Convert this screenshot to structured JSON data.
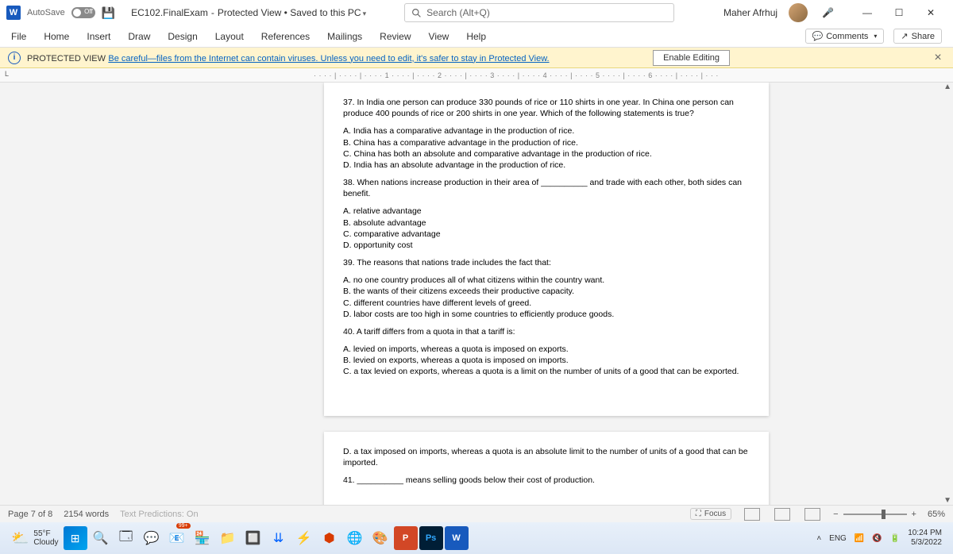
{
  "titlebar": {
    "word_letter": "W",
    "autosave": "AutoSave",
    "autosave_state": "Off",
    "doc_name": "EC102.FinalExam",
    "doc_status": "Protected View • Saved to this PC",
    "search_placeholder": "Search (Alt+Q)",
    "user": "Maher Afrhuj"
  },
  "tabs": {
    "file": "File",
    "home": "Home",
    "insert": "Insert",
    "draw": "Draw",
    "design": "Design",
    "layout": "Layout",
    "references": "References",
    "mailings": "Mailings",
    "review": "Review",
    "view": "View",
    "help": "Help",
    "comments": "Comments",
    "share": "Share"
  },
  "protected": {
    "label": "PROTECTED VIEW",
    "message": "Be careful—files from the Internet can contain viruses. Unless you need to edit, it's safer to stay in Protected View.",
    "enable": "Enable Editing"
  },
  "ruler": {
    "l": "L",
    "marks": "· · · · | · · · · | · · · · 1 · · · · | · · · · 2 · · · · | · · · · 3 · · · · | · · · · 4 · · · · | · · · · 5 · · · · | · · · · 6 · · · · | · · · · | · · ·"
  },
  "doc": {
    "q37": "37. In India one person can produce 330 pounds of rice or 110 shirts in one year. In China one person can produce 400 pounds of rice or 200 shirts in one year. Which of the following statements is true?",
    "q37a": "A. India has a comparative advantage in the production of rice.",
    "q37b": "B. China has a comparative advantage in the production of rice.",
    "q37c": "C. China has both an absolute and comparative advantage in the production of rice.",
    "q37d": "D. India has an absolute advantage in the production of rice.",
    "q38": "38. When nations increase production in their area of __________ and trade with each other, both sides can benefit.",
    "q38a": "A. relative advantage",
    "q38b": "B. absolute advantage",
    "q38c": "C. comparative advantage",
    "q38d": "D. opportunity cost",
    "q39": "39. The reasons that nations trade includes the fact that:",
    "q39a": "A. no one country produces all of what citizens within the country want.",
    "q39b": "B. the wants of their citizens exceeds their productive capacity.",
    "q39c": "C. different countries have different levels of greed.",
    "q39d": "D. labor costs are too high in some countries to efficiently produce goods.",
    "q40": "40. A tariff differs from a quota in that a tariff is:",
    "q40a": "A. levied on imports, whereas a quota is imposed on exports.",
    "q40b": "B. levied on exports, whereas a quota is imposed on imports.",
    "q40c": "C. a tax levied on exports, whereas a quota is a limit on the number of units of a good that can be exported.",
    "q40d": "D. a tax imposed on imports, whereas a quota is an absolute limit to the number of units of a good that can be imported.",
    "q41": "41. __________ means selling goods below their cost of production."
  },
  "status": {
    "page": "Page 7 of 8",
    "words": "2154 words",
    "predictions": "Text Predictions: On",
    "focus": "Focus",
    "zoom": "65%"
  },
  "taskbar": {
    "temp": "55°F",
    "weather": "Cloudy",
    "lang": "ENG",
    "time": "10:24 PM",
    "date": "5/3/2022"
  }
}
